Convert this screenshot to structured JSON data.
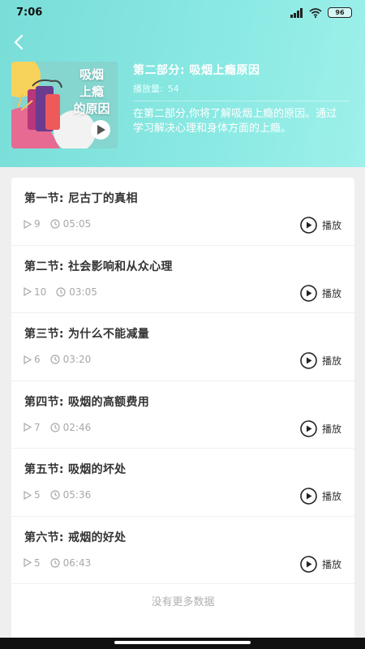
{
  "status_bar": {
    "time": "7:06",
    "battery": "96"
  },
  "header": {
    "cover_text": [
      "吸烟",
      "上瘾",
      "的原因"
    ],
    "title": "第二部分: 吸烟上瘾原因",
    "plays_label": "播放量:",
    "plays_value": "54",
    "description": "在第二部分,你将了解吸烟上瘾的原因。通过学习解决心理和身体方面的上瘾。"
  },
  "lessons": [
    {
      "title": "第一节: 尼古丁的真相",
      "count": "9",
      "duration": "05:05",
      "play_label": "播放"
    },
    {
      "title": "第二节: 社会影响和从众心理",
      "count": "10",
      "duration": "03:05",
      "play_label": "播放"
    },
    {
      "title": "第三节: 为什么不能减量",
      "count": "6",
      "duration": "03:20",
      "play_label": "播放"
    },
    {
      "title": "第四节: 吸烟的高额费用",
      "count": "7",
      "duration": "02:46",
      "play_label": "播放"
    },
    {
      "title": "第五节: 吸烟的坏处",
      "count": "5",
      "duration": "05:36",
      "play_label": "播放"
    },
    {
      "title": "第六节: 戒烟的好处",
      "count": "5",
      "duration": "06:43",
      "play_label": "播放"
    }
  ],
  "footer_text": "没有更多数据",
  "colors": {
    "header": "#8ae9e3",
    "accent": "#333333"
  }
}
